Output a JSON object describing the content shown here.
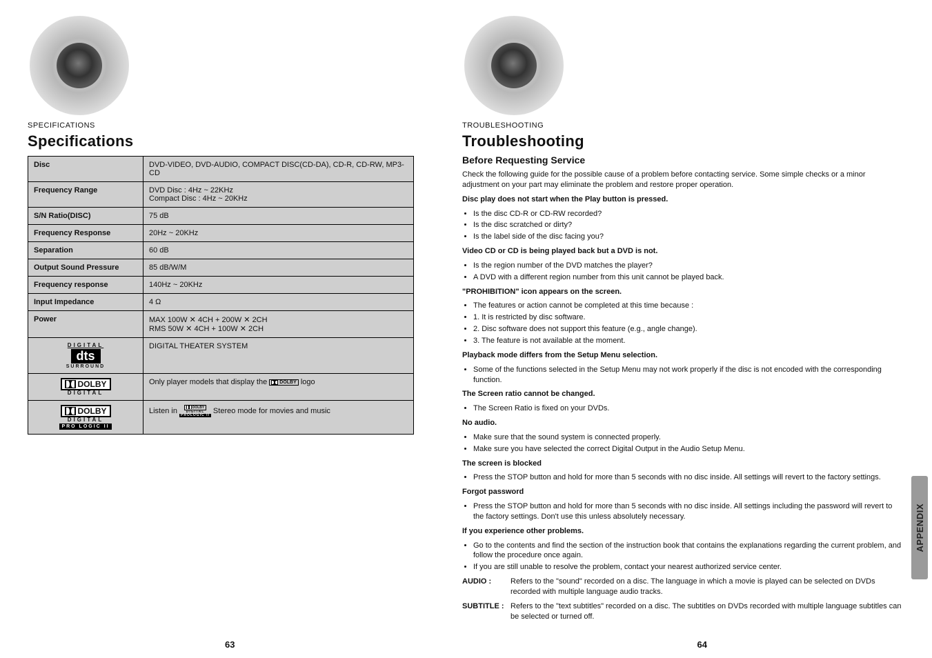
{
  "left": {
    "pageTitle": "Specifications",
    "sectionLabel": "SPECIFICATIONS",
    "pageNumber": "63",
    "tableRows": [
      {
        "k": "Disc",
        "v": "DVD-VIDEO, DVD-AUDIO, COMPACT DISC(CD-DA), CD-R, CD-RW, MP3-CD"
      },
      {
        "k": "Frequency Range",
        "v": "DVD Disc : 4Hz ~ 22KHz\nCompact Disc : 4Hz ~ 20KHz"
      },
      {
        "k": "S/N Ratio(DISC)",
        "v": "75 dB"
      },
      {
        "k": "Frequency Response",
        "v": "20Hz ~ 20KHz"
      },
      {
        "k": "Separation",
        "v": "60 dB"
      },
      {
        "k": "Output Sound Pressure",
        "v": "85 dB/W/M"
      },
      {
        "k": "Frequency response",
        "v": "140Hz ~ 20KHz"
      },
      {
        "k": "Input Impedance",
        "v": "4 Ω"
      },
      {
        "k": "Power",
        "v": "MAX 100W ✕ 4CH + 200W ✕ 2CH\nRMS 50W ✕ 4CH + 100W ✕ 2CH"
      }
    ],
    "dtsRow": "DIGITAL THEATER SYSTEM",
    "ddRow": {
      "pre": "Only player models that display the ",
      "post": " logo"
    },
    "plRow": {
      "pre": "Listen in ",
      "post": " Stereo mode for movies and music"
    }
  },
  "right": {
    "pageTitle": "Troubleshooting",
    "sectionLabel": "TROUBLESHOOTING",
    "subtitle": "Before Requesting Service",
    "intro": "Check the following guide for the possible cause of a problem before contacting service.\nSome simple checks or a minor adjustment on your part may eliminate the problem and restore proper operation.",
    "items": [
      {
        "h": "Disc play does not start when the Play button is pressed.",
        "b": [
          "Is the disc CD-R or CD-RW recorded?",
          "Is the disc scratched or dirty?",
          "Is the label side of the disc facing you?"
        ]
      },
      {
        "h": "Video CD or CD is being played back but a DVD is not.",
        "b": [
          "Is the region number of the DVD matches the player?",
          "A DVD with a different region number from this unit cannot be played back."
        ]
      },
      {
        "h": "\"PROHIBITION\" icon appears on the screen.",
        "b": [
          "The features or action cannot be completed at this time because :",
          "1. It is restricted by disc software.",
          "2. Disc software does not support this feature (e.g., angle change).",
          "3. The feature is not available at the moment."
        ]
      },
      {
        "h": "Playback mode differs from the Setup Menu selection.",
        "b": [
          "Some of the functions selected in the Setup Menu may not work properly if the disc is not encoded with the corresponding function."
        ]
      },
      {
        "h": "The Screen ratio cannot be changed.",
        "b": [
          "The Screen Ratio is fixed on your DVDs."
        ]
      },
      {
        "h": "No audio.",
        "b": [
          "Make sure that the sound system is connected properly.",
          "Make sure you have selected the correct Digital Output in the Audio Setup Menu."
        ]
      },
      {
        "h": "The screen is blocked",
        "b": [
          "Press the STOP button and hold for more than 5 seconds with no disc inside. All settings will revert to the factory settings."
        ]
      },
      {
        "h": "Forgot password",
        "b": [
          "Press the STOP button and hold for more than 5 seconds with no disc inside. All settings including the password will revert to the factory settings. Don't use this unless absolutely necessary."
        ]
      },
      {
        "h": "If you experience other problems.",
        "b": [
          "Go to the contents and find the section of the instruction book that contains the explanations regarding the current problem, and follow the procedure once again.",
          "If you are still unable to resolve the problem, contact your nearest authorized service center."
        ]
      }
    ],
    "defs": [
      {
        "k": "AUDIO :",
        "v": "Refers to the \"sound\" recorded on a disc. The language in which a movie is played can be selected on DVDs recorded with multiple language audio tracks."
      },
      {
        "k": "SUBTITLE :",
        "v": "Refers to the \"text subtitles\" recorded on a disc. The subtitles on DVDs recorded with multiple language subtitles can be selected or turned off."
      }
    ],
    "tabLabel": "APPENDIX",
    "pageNumber": "64"
  }
}
